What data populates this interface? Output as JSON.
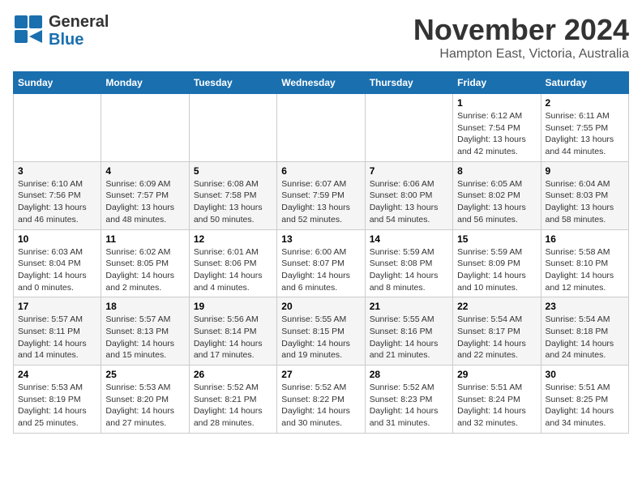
{
  "header": {
    "logo_line1": "General",
    "logo_line2": "Blue",
    "month": "November 2024",
    "location": "Hampton East, Victoria, Australia"
  },
  "weekdays": [
    "Sunday",
    "Monday",
    "Tuesday",
    "Wednesday",
    "Thursday",
    "Friday",
    "Saturday"
  ],
  "weeks": [
    [
      {
        "day": "",
        "info": ""
      },
      {
        "day": "",
        "info": ""
      },
      {
        "day": "",
        "info": ""
      },
      {
        "day": "",
        "info": ""
      },
      {
        "day": "",
        "info": ""
      },
      {
        "day": "1",
        "info": "Sunrise: 6:12 AM\nSunset: 7:54 PM\nDaylight: 13 hours\nand 42 minutes."
      },
      {
        "day": "2",
        "info": "Sunrise: 6:11 AM\nSunset: 7:55 PM\nDaylight: 13 hours\nand 44 minutes."
      }
    ],
    [
      {
        "day": "3",
        "info": "Sunrise: 6:10 AM\nSunset: 7:56 PM\nDaylight: 13 hours\nand 46 minutes."
      },
      {
        "day": "4",
        "info": "Sunrise: 6:09 AM\nSunset: 7:57 PM\nDaylight: 13 hours\nand 48 minutes."
      },
      {
        "day": "5",
        "info": "Sunrise: 6:08 AM\nSunset: 7:58 PM\nDaylight: 13 hours\nand 50 minutes."
      },
      {
        "day": "6",
        "info": "Sunrise: 6:07 AM\nSunset: 7:59 PM\nDaylight: 13 hours\nand 52 minutes."
      },
      {
        "day": "7",
        "info": "Sunrise: 6:06 AM\nSunset: 8:00 PM\nDaylight: 13 hours\nand 54 minutes."
      },
      {
        "day": "8",
        "info": "Sunrise: 6:05 AM\nSunset: 8:02 PM\nDaylight: 13 hours\nand 56 minutes."
      },
      {
        "day": "9",
        "info": "Sunrise: 6:04 AM\nSunset: 8:03 PM\nDaylight: 13 hours\nand 58 minutes."
      }
    ],
    [
      {
        "day": "10",
        "info": "Sunrise: 6:03 AM\nSunset: 8:04 PM\nDaylight: 14 hours\nand 0 minutes."
      },
      {
        "day": "11",
        "info": "Sunrise: 6:02 AM\nSunset: 8:05 PM\nDaylight: 14 hours\nand 2 minutes."
      },
      {
        "day": "12",
        "info": "Sunrise: 6:01 AM\nSunset: 8:06 PM\nDaylight: 14 hours\nand 4 minutes."
      },
      {
        "day": "13",
        "info": "Sunrise: 6:00 AM\nSunset: 8:07 PM\nDaylight: 14 hours\nand 6 minutes."
      },
      {
        "day": "14",
        "info": "Sunrise: 5:59 AM\nSunset: 8:08 PM\nDaylight: 14 hours\nand 8 minutes."
      },
      {
        "day": "15",
        "info": "Sunrise: 5:59 AM\nSunset: 8:09 PM\nDaylight: 14 hours\nand 10 minutes."
      },
      {
        "day": "16",
        "info": "Sunrise: 5:58 AM\nSunset: 8:10 PM\nDaylight: 14 hours\nand 12 minutes."
      }
    ],
    [
      {
        "day": "17",
        "info": "Sunrise: 5:57 AM\nSunset: 8:11 PM\nDaylight: 14 hours\nand 14 minutes."
      },
      {
        "day": "18",
        "info": "Sunrise: 5:57 AM\nSunset: 8:13 PM\nDaylight: 14 hours\nand 15 minutes."
      },
      {
        "day": "19",
        "info": "Sunrise: 5:56 AM\nSunset: 8:14 PM\nDaylight: 14 hours\nand 17 minutes."
      },
      {
        "day": "20",
        "info": "Sunrise: 5:55 AM\nSunset: 8:15 PM\nDaylight: 14 hours\nand 19 minutes."
      },
      {
        "day": "21",
        "info": "Sunrise: 5:55 AM\nSunset: 8:16 PM\nDaylight: 14 hours\nand 21 minutes."
      },
      {
        "day": "22",
        "info": "Sunrise: 5:54 AM\nSunset: 8:17 PM\nDaylight: 14 hours\nand 22 minutes."
      },
      {
        "day": "23",
        "info": "Sunrise: 5:54 AM\nSunset: 8:18 PM\nDaylight: 14 hours\nand 24 minutes."
      }
    ],
    [
      {
        "day": "24",
        "info": "Sunrise: 5:53 AM\nSunset: 8:19 PM\nDaylight: 14 hours\nand 25 minutes."
      },
      {
        "day": "25",
        "info": "Sunrise: 5:53 AM\nSunset: 8:20 PM\nDaylight: 14 hours\nand 27 minutes."
      },
      {
        "day": "26",
        "info": "Sunrise: 5:52 AM\nSunset: 8:21 PM\nDaylight: 14 hours\nand 28 minutes."
      },
      {
        "day": "27",
        "info": "Sunrise: 5:52 AM\nSunset: 8:22 PM\nDaylight: 14 hours\nand 30 minutes."
      },
      {
        "day": "28",
        "info": "Sunrise: 5:52 AM\nSunset: 8:23 PM\nDaylight: 14 hours\nand 31 minutes."
      },
      {
        "day": "29",
        "info": "Sunrise: 5:51 AM\nSunset: 8:24 PM\nDaylight: 14 hours\nand 32 minutes."
      },
      {
        "day": "30",
        "info": "Sunrise: 5:51 AM\nSunset: 8:25 PM\nDaylight: 14 hours\nand 34 minutes."
      }
    ]
  ]
}
